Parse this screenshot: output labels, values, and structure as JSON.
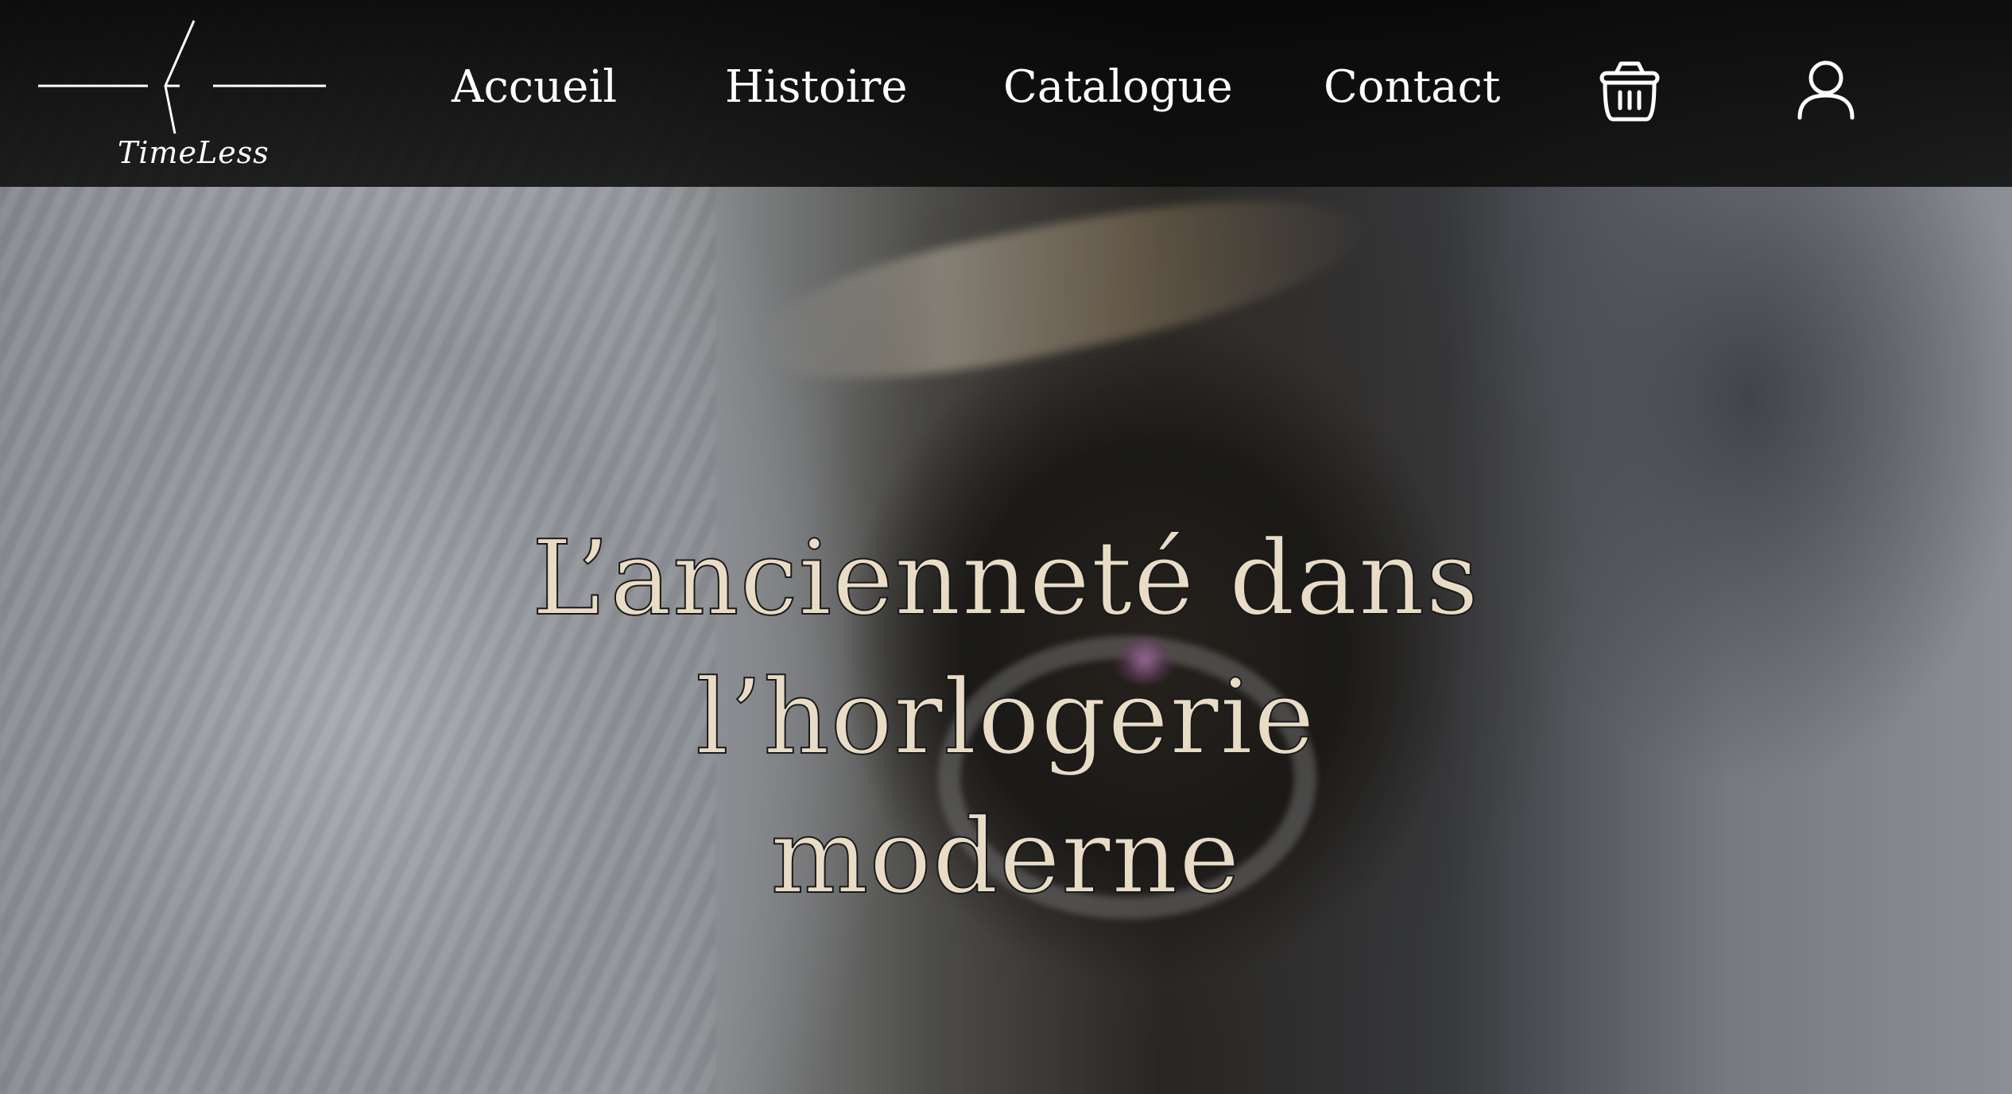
{
  "brand": {
    "name": "TimeLess"
  },
  "nav": {
    "items": [
      {
        "label": "Accueil"
      },
      {
        "label": "Histoire"
      },
      {
        "label": "Catalogue"
      },
      {
        "label": "Contact"
      }
    ]
  },
  "icons": {
    "cart": "basket-icon",
    "account": "user-icon"
  },
  "hero": {
    "headline_line1": "L’ancienneté dans l’horlogerie",
    "headline_line2": "moderne"
  },
  "colors": {
    "header_bg": "#0c0c0c",
    "nav_text": "#ffffff",
    "headline_fill": "#e9dcc6",
    "headline_outline": "#1a1a1a"
  }
}
